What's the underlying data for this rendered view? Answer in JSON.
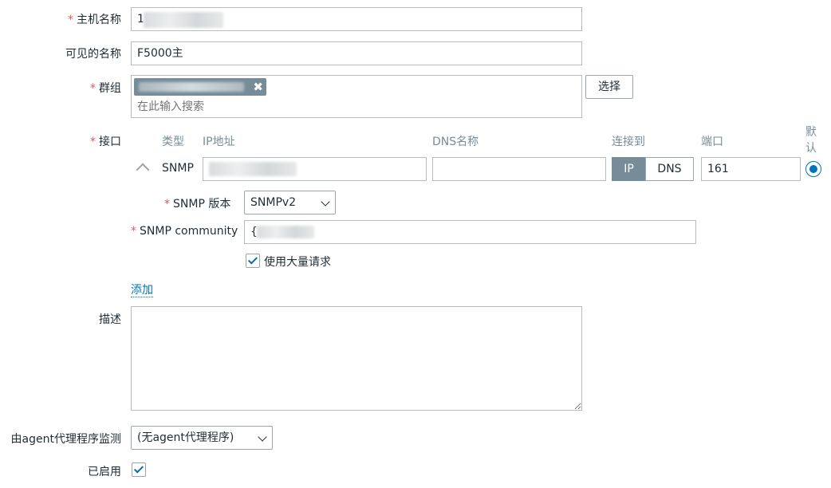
{
  "form": {
    "hostname": {
      "label": "主机名称",
      "value": "1"
    },
    "visible_name": {
      "label": "可见的名称",
      "value": "F5000主"
    },
    "groups": {
      "label": "群组",
      "tag_text": "...",
      "placeholder": "在此输入搜索",
      "select_button": "选择"
    },
    "interfaces": {
      "label": "接口",
      "headers": {
        "type": "类型",
        "ip": "IP地址",
        "dns": "DNS名称",
        "connect_to": "连接到",
        "port": "端口",
        "default": "默认"
      },
      "row": {
        "type": "SNMP",
        "ip_value": "",
        "dns_value": "",
        "connect_ip": "IP",
        "connect_dns": "DNS",
        "connect_selected": "IP",
        "port": "161",
        "default_selected": true
      },
      "snmp_version": {
        "label": "SNMP 版本",
        "value": "SNMPv2"
      },
      "snmp_community": {
        "label": "SNMP community",
        "value": "{"
      },
      "bulk_requests": {
        "label": "使用大量请求",
        "checked": true
      },
      "add_link": "添加"
    },
    "description": {
      "label": "描述",
      "value": ""
    },
    "monitored_by_proxy": {
      "label": "由agent代理程序监测",
      "value": "(无agent代理程序)"
    },
    "enabled": {
      "label": "已启用",
      "checked": true
    }
  },
  "colors": {
    "required": "#e45959",
    "link": "#0275b8",
    "segment_active": "#768d99",
    "checkbox_mark": "#0b6ba8"
  }
}
